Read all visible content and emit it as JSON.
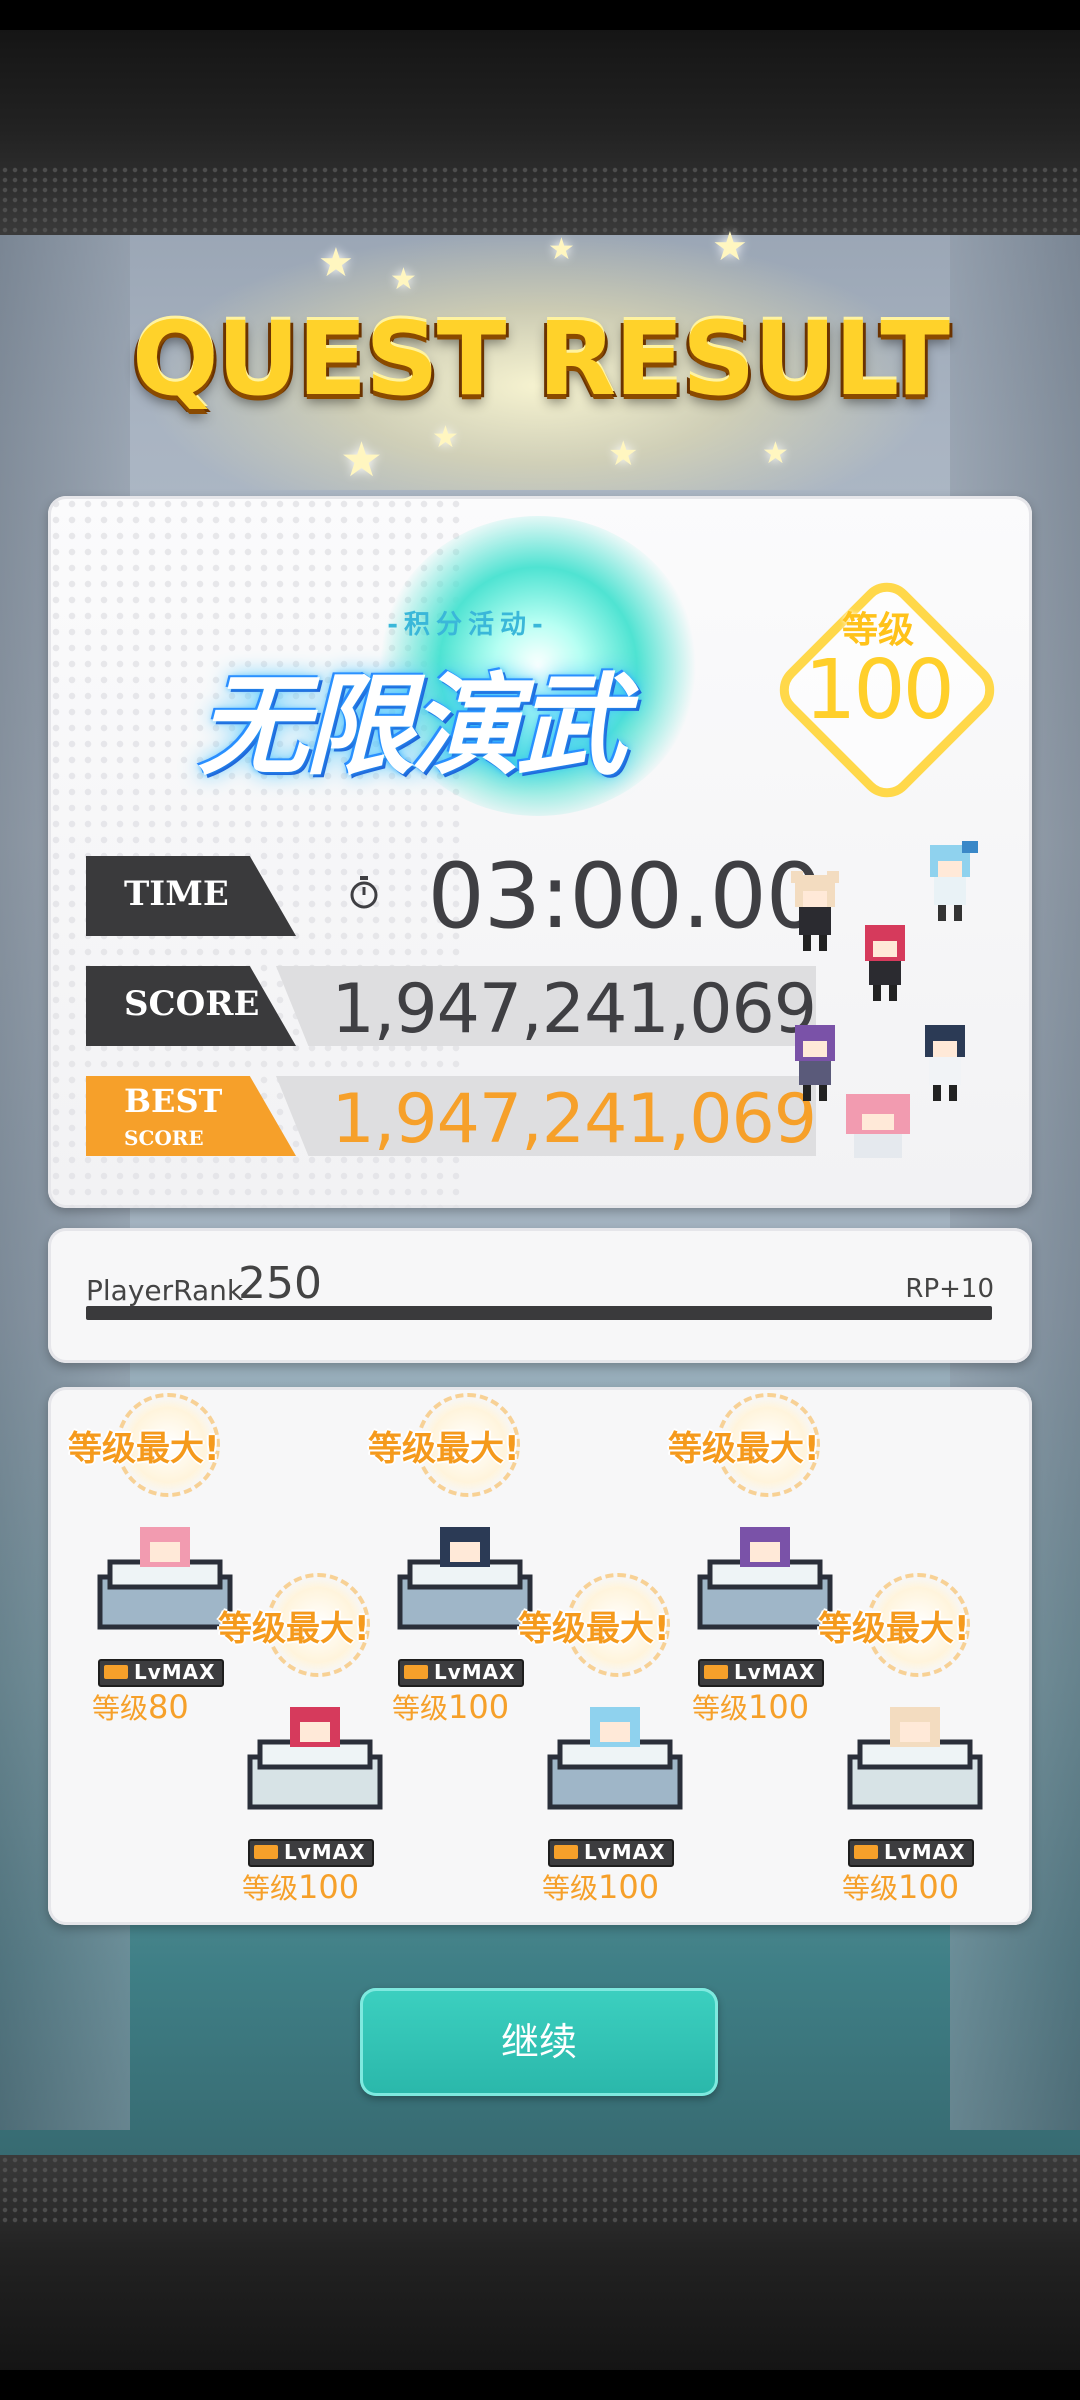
{
  "title": "QUEST RESULT",
  "event_logo": {
    "subtitle": "-积分活动-",
    "name": "无限演武"
  },
  "level_badge": {
    "label": "等级",
    "value": "100"
  },
  "stats": {
    "time_label": "TIME",
    "time_value": "03:00.00",
    "score_label": "SCORE",
    "score_value": "1,947,241,069",
    "best_label": "BEST",
    "best_sub": "SCORE",
    "best_value": "1,947,241,069"
  },
  "player_rank": {
    "label": "PlayerRank",
    "value": "250",
    "rp": "RP+10",
    "progress": 1.0
  },
  "units": [
    {
      "badge": "等级最大!",
      "max_label": "LvMAX",
      "level_prefix": "等级",
      "level": "80",
      "hair": "#f29bb0",
      "pedestal": "#9fb6c8"
    },
    {
      "badge": "等级最大!",
      "max_label": "LvMAX",
      "level_prefix": "等级",
      "level": "100",
      "hair": "#d63a5c",
      "pedestal": "#d7e3e6"
    },
    {
      "badge": "等级最大!",
      "max_label": "LvMAX",
      "level_prefix": "等级",
      "level": "100",
      "hair": "#2b3a55",
      "pedestal": "#9fb6c8"
    },
    {
      "badge": "等级最大!",
      "max_label": "LvMAX",
      "level_prefix": "等级",
      "level": "100",
      "hair": "#8fd2ee",
      "pedestal": "#9fb6c8"
    },
    {
      "badge": "等级最大!",
      "max_label": "LvMAX",
      "level_prefix": "等级",
      "level": "100",
      "hair": "#7a52a8",
      "pedestal": "#9fb6c8"
    },
    {
      "badge": "等级最大!",
      "max_label": "LvMAX",
      "level_prefix": "等级",
      "level": "100",
      "hair": "#f3dcc0",
      "pedestal": "#d7e3e6"
    }
  ],
  "continue_label": "继续",
  "colors": {
    "accent_orange": "#f6a02a",
    "gold": "#ffd22a",
    "teal_button": "#2ab7aa"
  }
}
